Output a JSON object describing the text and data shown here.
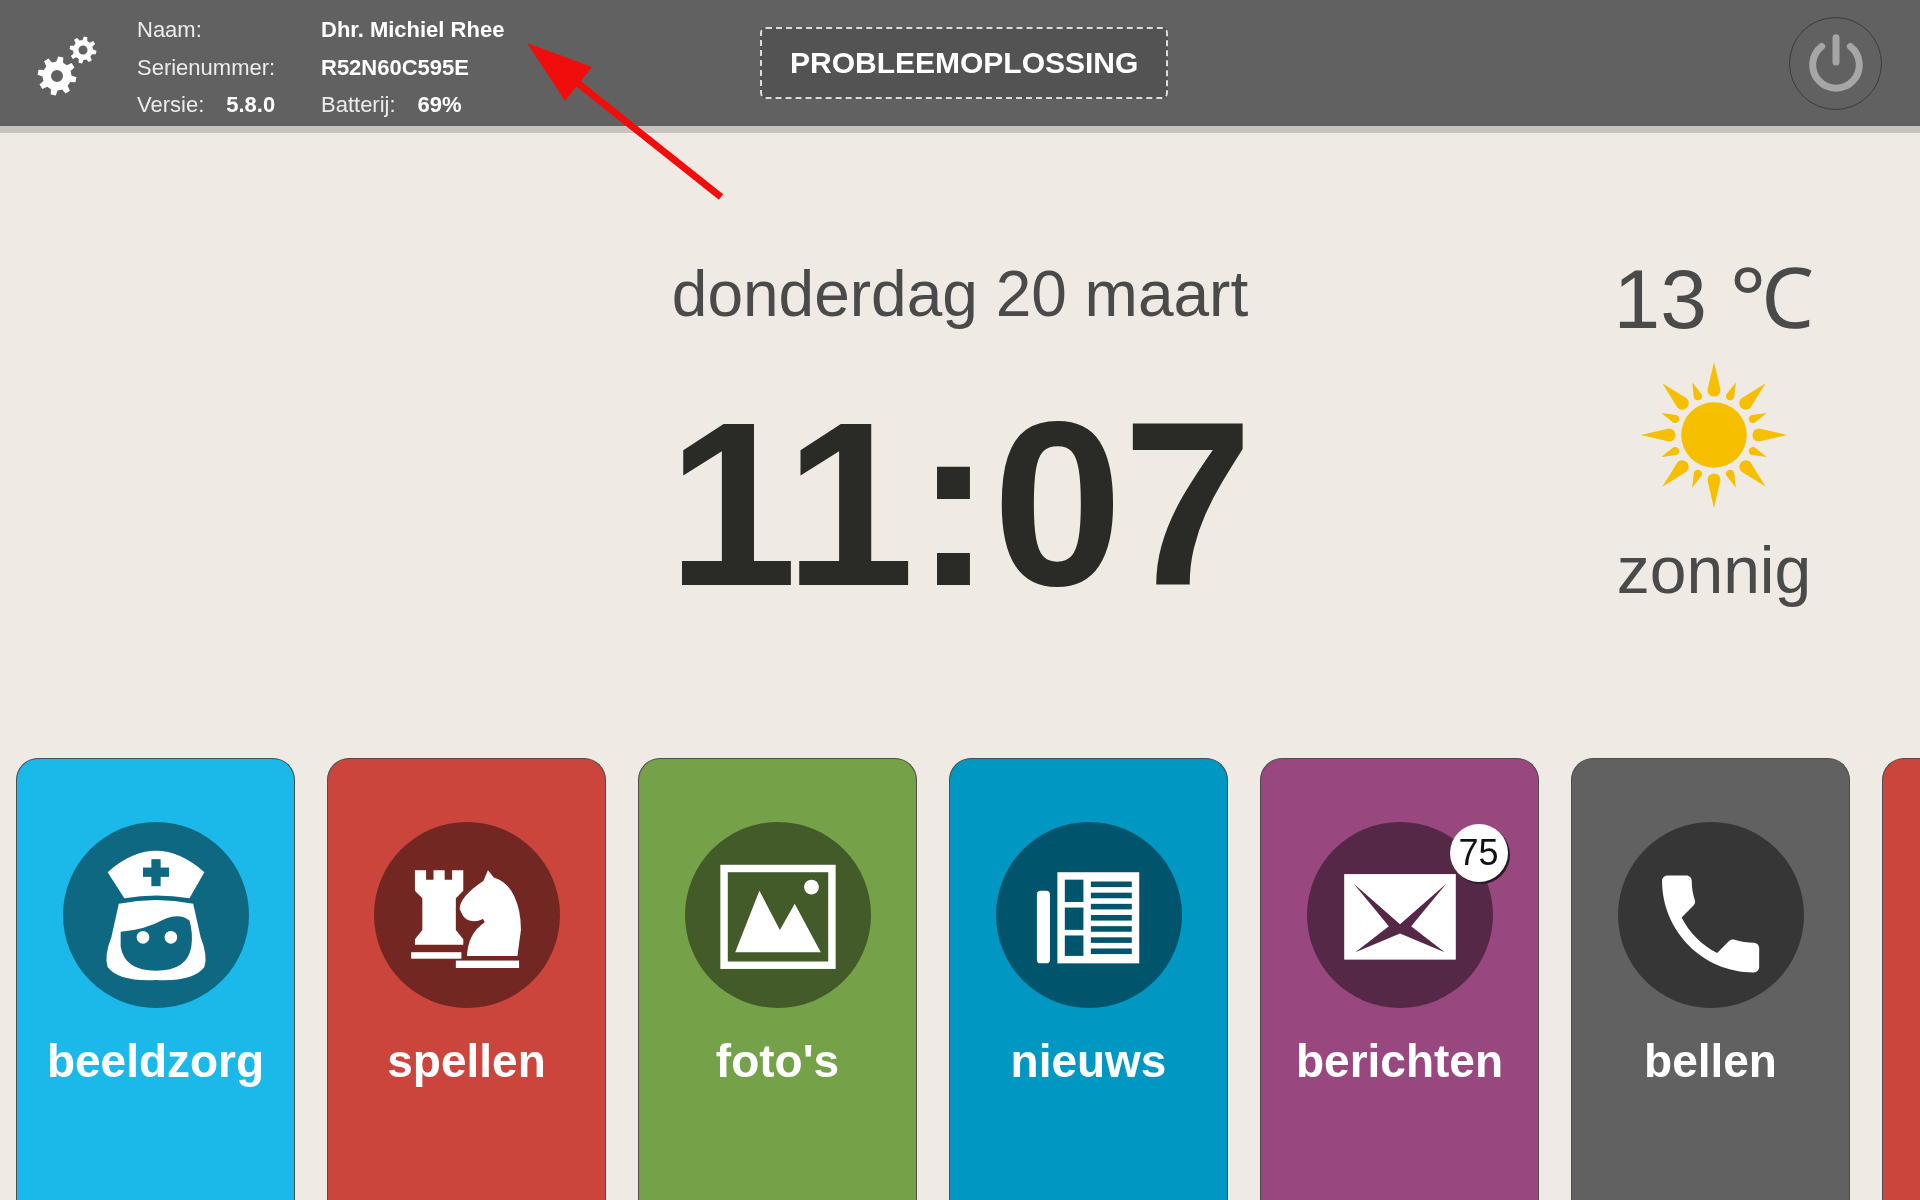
{
  "header": {
    "info": {
      "name": {
        "label": "Naam:",
        "value": "Dhr. Michiel Rhee"
      },
      "serial": {
        "label": "Serienummer:",
        "value": "R52N60C595E"
      },
      "version": {
        "label": "Versie:",
        "value": "5.8.0"
      },
      "battery": {
        "label": "Batterij:",
        "value": "69%"
      }
    },
    "troubleshoot_button": "PROBLEEMOPLOSSING"
  },
  "date": "donderdag 20 maart",
  "time": "11:07",
  "weather": {
    "temperature": "13 ℃",
    "condition": "zonnig"
  },
  "tiles": [
    {
      "kind": "care",
      "label": "beeldzorg",
      "color": "#1ab9e9"
    },
    {
      "kind": "games",
      "label": "spellen",
      "color": "#cb453c"
    },
    {
      "kind": "photos",
      "label": "foto's",
      "color": "#75a249"
    },
    {
      "kind": "news",
      "label": "nieuws",
      "color": "#0097c2"
    },
    {
      "kind": "messages",
      "label": "berichten",
      "color": "#98487e",
      "badge": "75"
    },
    {
      "kind": "calls",
      "label": "bellen",
      "color": "#616161"
    },
    {
      "color": "#cb453c"
    }
  ]
}
